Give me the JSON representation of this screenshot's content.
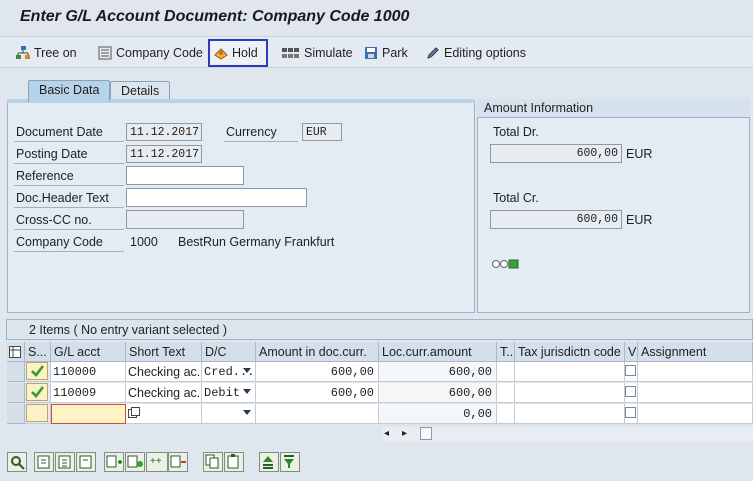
{
  "title": "Enter G/L Account Document: Company Code 1000",
  "toolbar": {
    "tree_on": "Tree on",
    "company_code": "Company Code",
    "hold": "Hold",
    "simulate": "Simulate",
    "park": "Park",
    "editing_options": "Editing options"
  },
  "tabs": {
    "basic_data": "Basic Data",
    "details": "Details"
  },
  "basic": {
    "document_date_label": "Document Date",
    "document_date": "11.12.2017",
    "currency_label": "Currency",
    "currency": "EUR",
    "posting_date_label": "Posting Date",
    "posting_date": "11.12.2017",
    "reference_label": "Reference",
    "reference": "",
    "doc_header_text_label": "Doc.Header Text",
    "doc_header_text": "",
    "cross_cc_label": "Cross-CC no.",
    "cross_cc": "",
    "company_code_label": "Company Code",
    "company_code": "1000",
    "company_name": "BestRun Germany Frankfurt"
  },
  "amount_info": {
    "title": "Amount Information",
    "total_dr_label": "Total Dr.",
    "total_dr": "600,00",
    "total_dr_currency": "EUR",
    "total_cr_label": "Total Cr.",
    "total_cr": "600,00",
    "total_cr_currency": "EUR",
    "status_light": "green"
  },
  "items": {
    "title": "2 Items ( No entry variant selected )",
    "columns": [
      "S...",
      "G/L acct",
      "Short Text",
      "D/C",
      "Amount in doc.curr.",
      "Loc.curr.amount",
      "T..",
      "Tax jurisdictn code",
      "V",
      "Assignment"
    ],
    "rows": [
      {
        "status": "ok",
        "gl_acct": "110000",
        "short_text": "Checking ac...",
        "dc": "Cred...",
        "amount": "600,00",
        "loc_amount": "600,00"
      },
      {
        "status": "ok",
        "gl_acct": "110009",
        "short_text": "Checking ac...",
        "dc": "Debit",
        "amount": "600,00",
        "loc_amount": "600,00"
      },
      {
        "status": "",
        "gl_acct": "",
        "short_text": "",
        "dc": "",
        "amount": "",
        "loc_amount": "0,00"
      }
    ]
  },
  "colors": {
    "background": "#dfe6ee",
    "focus_border": "#2b3cb8",
    "status_green": "#3aa13a"
  }
}
